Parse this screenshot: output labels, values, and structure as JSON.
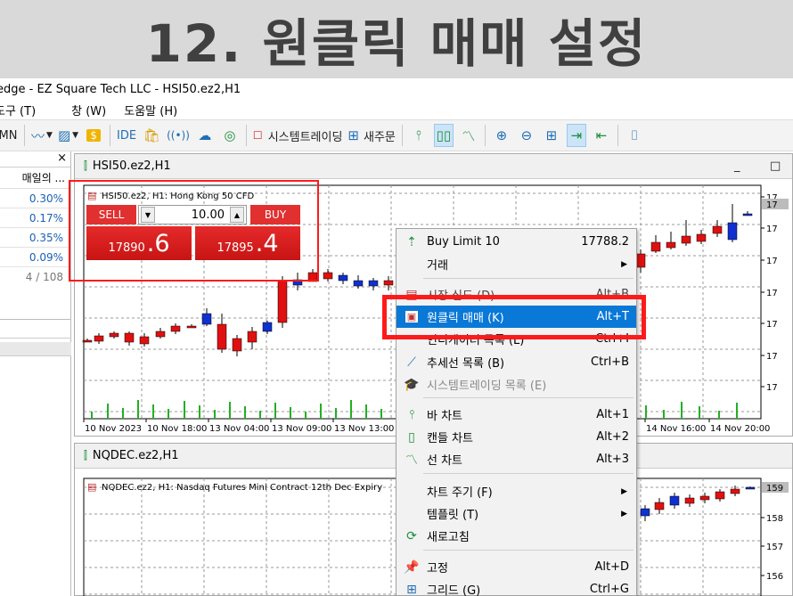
{
  "banner": {
    "title": "12. 원클릭 매매 설정"
  },
  "window": {
    "title": "edge - EZ Square Tech LLC - HSI50.ez2,H1"
  },
  "menubar": {
    "items": [
      "도구 (T)",
      "창 (W)",
      "도움말 (H)"
    ]
  },
  "toolbar": {
    "mn_label": "MN",
    "ide_label": "IDE",
    "systrade_label": "시스템트레이딩",
    "neworder_label": "새주문"
  },
  "marketwatch": {
    "column": "매일의 ...",
    "rows": [
      "0.30%",
      "0.17%",
      "0.35%",
      "0.09%"
    ],
    "count": "4 / 108"
  },
  "chart1": {
    "tab_title": "HSI50.ez2,H1",
    "header": "HSI50.ez2, H1:  Hong Kong 50 CFD",
    "time_labels": [
      "10 Nov 2023",
      "10 Nov 18:00",
      "13 Nov 04:00",
      "13 Nov 09:00",
      "13 Nov 13:00",
      "14 Nov 16:00",
      "14 Nov 20:00"
    ],
    "price_labels": [
      "17",
      "17",
      "17",
      "17",
      "17",
      "17",
      "17"
    ],
    "bid_label": "17"
  },
  "chart2": {
    "tab_title": "NQDEC.ez2,H1",
    "header": "NQDEC.ez2, H1:  Nasdaq Futures Mini Contract 12th Dec Expiry",
    "price_labels": [
      "158",
      "157",
      "156"
    ],
    "bid_label": "159"
  },
  "oneclick": {
    "sell_label": "SELL",
    "buy_label": "BUY",
    "volume": "10.00",
    "sell_price_prefix": "17890",
    "sell_price_suffix": ".6",
    "buy_price_prefix": "17895",
    "buy_price_suffix": ".4"
  },
  "context_menu": {
    "items": [
      {
        "label": "Buy Limit 10",
        "shortcut": "17788.2",
        "icon": "buy-limit-icon"
      },
      {
        "label": "거래",
        "submenu": true
      },
      {
        "label": "시장 심도 (D)",
        "shortcut": "Alt+B",
        "icon": "depth-icon"
      },
      {
        "label": "원클릭 매매 (K)",
        "shortcut": "Alt+T",
        "icon": "oneclick-icon",
        "selected": true
      },
      {
        "label": "인디케이터 목록 (L)",
        "shortcut": "Ctrl+I"
      },
      {
        "label": "추세선 목록 (B)",
        "shortcut": "Ctrl+B",
        "icon": "trendline-icon"
      },
      {
        "label": "시스템트레이딩 목록 (E)",
        "icon": "hat-icon",
        "disabled": true
      },
      {
        "label": "바 차트",
        "shortcut": "Alt+1",
        "icon": "bar-chart-icon"
      },
      {
        "label": "캔들 차트",
        "shortcut": "Alt+2",
        "icon": "candle-chart-icon"
      },
      {
        "label": "선 차트",
        "shortcut": "Alt+3",
        "icon": "line-chart-icon"
      },
      {
        "label": "차트 주기 (F)",
        "submenu": true
      },
      {
        "label": "템플릿 (T)",
        "submenu": true
      },
      {
        "label": "새로고침",
        "icon": "refresh-icon"
      },
      {
        "label": "고정",
        "shortcut": "Alt+D",
        "icon": "pin-icon"
      },
      {
        "label": "그리드 (G)",
        "shortcut": "Ctrl+G",
        "icon": "grid-icon"
      }
    ]
  },
  "colors": {
    "highlight": "#ff1a1a",
    "bear": "#e01010",
    "bull": "#1030d0",
    "volume": "#22b022",
    "selected": "#0a78d7"
  }
}
